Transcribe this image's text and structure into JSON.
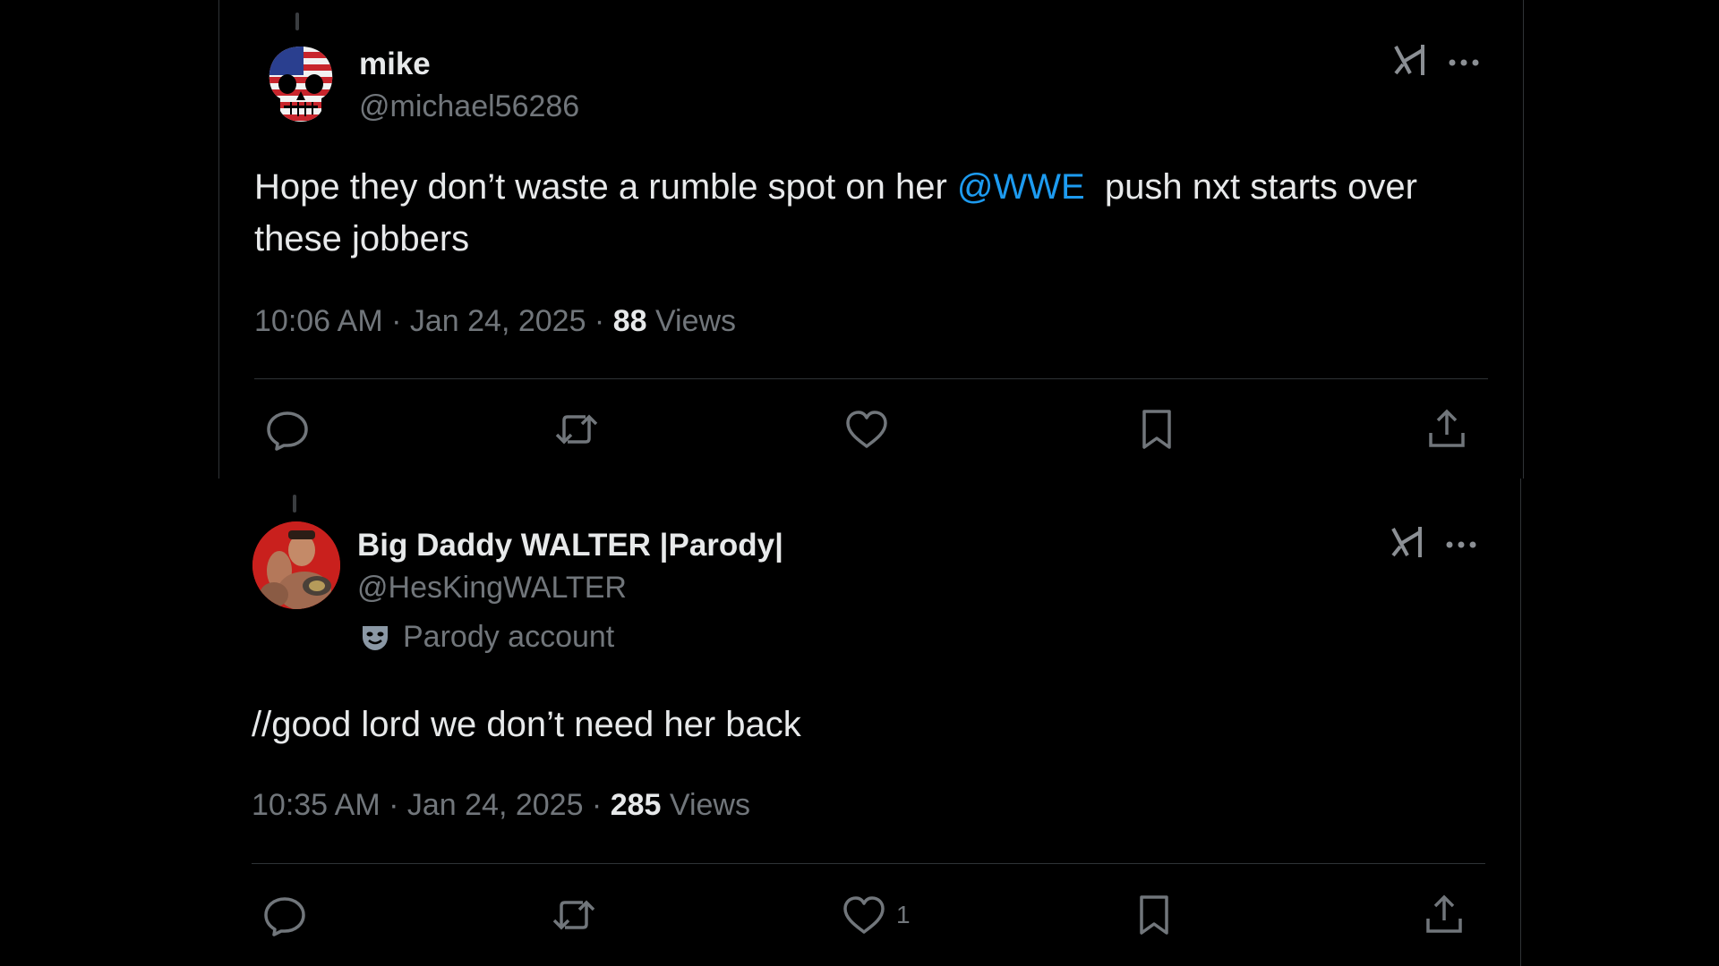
{
  "tweets": [
    {
      "display_name": "mike",
      "handle": "@michael56286",
      "text_before": "Hope they don’t waste a rumble spot on her ",
      "mention": "@WWE",
      "text_after": "  push nxt starts over these jobbers",
      "time": "10:06 AM · Jan 24, 2025 · ",
      "views_count": "88",
      "views_label": " Views",
      "actions": {
        "reply": "",
        "repost": "",
        "like": "",
        "bookmark": "",
        "share": ""
      }
    },
    {
      "display_name": "Big Daddy WALTER |Parody|",
      "handle": "@HesKingWALTER",
      "parody_label": "Parody account",
      "text": "//good lord we don’t need her back",
      "time": "10:35 AM · Jan 24, 2025 · ",
      "views_count": "285",
      "views_label": " Views",
      "actions": {
        "reply": "",
        "repost": "",
        "like": "1",
        "bookmark": "",
        "share": ""
      }
    }
  ],
  "colors": {
    "background": "#000000",
    "text": "#e7e9ea",
    "secondary": "#71767b",
    "accent": "#1d9bf0",
    "border": "#2f3336"
  },
  "icons": [
    "grok-icon",
    "more-icon",
    "reply-icon",
    "repost-icon",
    "like-icon",
    "bookmark-icon",
    "share-icon",
    "parody-mask-icon"
  ]
}
